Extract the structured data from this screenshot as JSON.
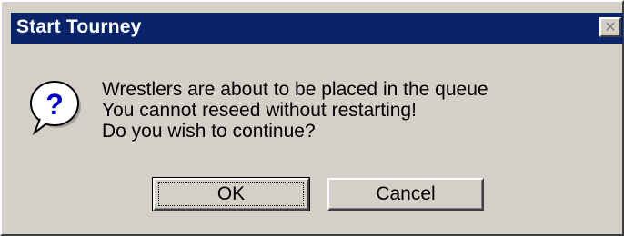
{
  "window": {
    "title": "Start Tourney",
    "close_glyph": "✕"
  },
  "icon": {
    "name": "question-icon",
    "glyph": "?",
    "color": "#0000cc"
  },
  "message": {
    "lines": [
      "Wrestlers are about to be placed in the queue",
      "You cannot reseed without restarting!",
      "Do you wish to continue?"
    ]
  },
  "buttons": {
    "ok_label": "OK",
    "cancel_label": "Cancel"
  },
  "colors": {
    "titlebar": "#0a246a",
    "face": "#d4d0c8"
  }
}
